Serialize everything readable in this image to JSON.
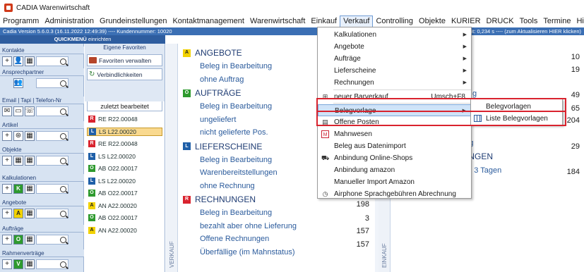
{
  "window": {
    "title": "CADIA Warenwirtschaft"
  },
  "menu": [
    "Programm",
    "Administration",
    "Grundeinstellungen",
    "Kontaktmanagement",
    "Warenwirtschaft",
    "Einkauf",
    "Verkauf",
    "Controlling",
    "Objekte",
    "KURIER",
    "DRUCK",
    "Tools",
    "Termine",
    "Hilfe"
  ],
  "version_bar": {
    "left": "Cadia Version 5.6.0.3  (16.11.2022 12:49:39) ---- Kundennummer: 10020",
    "right": "ungszeit: 0,234 s ---- (zum Aktualisieren HIER klicken)"
  },
  "quickmenu": {
    "label": "QUICKMENÜ",
    "suffix": "einrichten"
  },
  "left_sections": [
    {
      "label": "Kontakte"
    },
    {
      "label": "Ansprechpartner"
    },
    {
      "label": "Email | Tapi  | Telefon-Nr"
    },
    {
      "label": "Artikel"
    },
    {
      "label": "Objekte"
    },
    {
      "label": "Kalkulationen"
    },
    {
      "label": "Angebote"
    },
    {
      "label": "Aufträge"
    },
    {
      "label": "Rahmenverträge"
    }
  ],
  "favorites": {
    "header": "Eigene Favoriten",
    "items": [
      "Favoriten verwalten",
      "Verbindlichkeiten"
    ]
  },
  "recent": {
    "header": "zuletzt bearbeitet",
    "items": [
      {
        "letter": "R",
        "color": "#d9232e",
        "text": "RE R22.00048"
      },
      {
        "letter": "L",
        "color": "#1f5fa8",
        "text": "LS L22.00020",
        "selected": true
      },
      {
        "letter": "R",
        "color": "#d9232e",
        "text": "RE R22.00048"
      },
      {
        "letter": "L",
        "color": "#1f5fa8",
        "text": "LS L22.00020"
      },
      {
        "letter": "O",
        "color": "#2e9a2e",
        "text": "AB O22.00017"
      },
      {
        "letter": "L",
        "color": "#1f5fa8",
        "text": "LS L22.00020"
      },
      {
        "letter": "O",
        "color": "#2e9a2e",
        "text": "AB O22.00017"
      },
      {
        "letter": "A",
        "color": "#f2d200",
        "text": "AN A22.00020"
      },
      {
        "letter": "O",
        "color": "#2e9a2e",
        "text": "AB O22.00017"
      },
      {
        "letter": "A",
        "color": "#f2d200",
        "text": "AN A22.00020"
      }
    ]
  },
  "verkauf_panel": {
    "vertical_label": "VERKAUF",
    "sections": [
      {
        "letter": "A",
        "color": "#f2d200",
        "title": "ANGEBOTE",
        "lines": [
          "Beleg in Bearbeitung",
          "ohne Auftrag"
        ]
      },
      {
        "letter": "O",
        "color": "#2e9a2e",
        "title": "AUFTRÄGE",
        "lines": [
          "Beleg in Bearbeitung",
          "ungeliefert",
          "nicht gelieferte Pos."
        ]
      },
      {
        "letter": "L",
        "color": "#1f5fa8",
        "title": "LIEFERSCHEINE",
        "lines": [
          "Beleg in Bearbeitung",
          "Warenbereitstellungen",
          "ohne Rechnung"
        ]
      },
      {
        "letter": "R",
        "color": "#d9232e",
        "title": "RECHNUNGEN",
        "lines": [
          "Beleg in Bearbeitung",
          "bezahlt aber ohne Lieferung",
          "Offene Rechnungen",
          "Überfällige (im Mahnstatus)"
        ]
      }
    ],
    "numbers": [
      "198",
      "3",
      "157",
      "157"
    ]
  },
  "einkauf_panel": {
    "vertical_label": "EINKAUF",
    "lines": [
      "g",
      "nung",
      "NUNGEN",
      "en 3 Tagen"
    ],
    "headers": [
      "GE"
    ],
    "numbers": [
      "10",
      "19",
      "49",
      "65",
      "204",
      "29",
      "184"
    ]
  },
  "verkauf_menu": {
    "items": [
      {
        "label": "Kalkulationen",
        "submenu": true
      },
      {
        "label": "Angebote",
        "submenu": true
      },
      {
        "label": "Aufträge",
        "submenu": true
      },
      {
        "label": "Lieferscheine",
        "submenu": true
      },
      {
        "label": "Rechnungen",
        "submenu": true
      },
      {
        "label": "neuer Barverkauf",
        "shortcut": "Umsch+F8",
        "icon": "plus-icon"
      },
      {
        "label": "Belegvorlage",
        "submenu": true,
        "highlight": true
      },
      {
        "label": "Offene Posten",
        "icon": "open-items-icon"
      },
      {
        "label": "Mahnwesen",
        "icon": "dunning-icon"
      },
      {
        "label": "Beleg aus Datenimport"
      },
      {
        "label": "Anbindung Online-Shops",
        "icon": "cart-icon"
      },
      {
        "label": "Anbindung amazon"
      },
      {
        "label": "Manueller Import Amazon"
      },
      {
        "label": "Airphone Sprachgebühren Abrechnung",
        "icon": "clock-icon"
      }
    ]
  },
  "belegvorlage_submenu": {
    "items": [
      "Belegvorlagen",
      "Liste Belegvorlagen"
    ]
  }
}
